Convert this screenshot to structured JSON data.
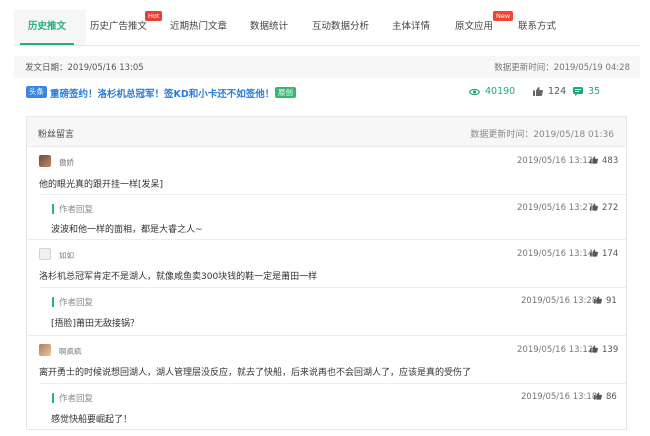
{
  "tabs": [
    {
      "label": "历史推文",
      "active": true
    },
    {
      "label": "历史广告推文",
      "badge": "Hot"
    },
    {
      "label": "近期热门文章"
    },
    {
      "label": "数据统计"
    },
    {
      "label": "互动数据分析"
    },
    {
      "label": "主体详情"
    },
    {
      "label": "原文应用",
      "badge": "New"
    },
    {
      "label": "联系方式"
    }
  ],
  "meta": {
    "publish_date": "发文日期：2019/05/16 13:05",
    "data_updated": "数据更新时间：2019/05/19 04:28"
  },
  "article": {
    "source_tag": "头条",
    "title": "重磅签约！洛杉机总冠军！签KD和小卡还不如签他！",
    "original_tag": "原创",
    "reads": "40190",
    "likes": "124",
    "comments": "35",
    "colors": {
      "accent": "#24b37a",
      "link": "#2a7bd8",
      "hot": "#e54035"
    }
  },
  "panel": {
    "title": "粉丝留言",
    "updated": "数据更新时间：2019/05/18 01:36"
  },
  "comments": [
    {
      "user": "傲娇",
      "time": "2019/05/16 13:12",
      "likes": "483",
      "text": "他的眼光真的跟开挂一样[发呆]",
      "reply": {
        "label": "作者回复",
        "time": "2019/05/16 13:27",
        "likes": "272",
        "text": "波波和他一样的面相，都是大睿之人~"
      }
    },
    {
      "user": "如如",
      "time": "2019/05/16 13:14",
      "likes": "174",
      "text": "洛杉机总冠军肯定不是湖人，就像咸鱼卖300块钱的鞋一定是莆田一样",
      "reply": {
        "label": "作者回复",
        "time": "2019/05/16 13:28",
        "likes": "91",
        "text": "[捂脸]莆田无敌接锅？"
      }
    },
    {
      "user": "啊疯疯",
      "time": "2019/05/16 13:12",
      "likes": "139",
      "text": "离开勇士的时候说想回湖人，湖人管理层没反应，就去了快船，后来说再也不会回湖人了，应该是真的受伤了",
      "reply": {
        "label": "作者回复",
        "time": "2019/05/16 13:18",
        "likes": "86",
        "text": "感觉快船要崛起了！"
      }
    }
  ]
}
